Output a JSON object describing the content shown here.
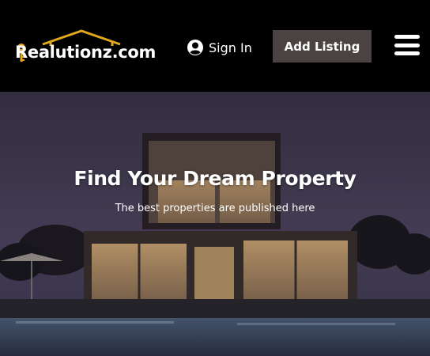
{
  "header": {
    "logo": {
      "text": "Realutionz.com",
      "colors": {
        "roof": "#e2a81e",
        "key": "#e2a81e"
      }
    },
    "sign_in": {
      "label": "Sign In",
      "icon": "user-circle-icon"
    },
    "add_listing": {
      "label": "Add Listing",
      "background": "#4a4341"
    },
    "menu": {
      "icon": "hamburger-menu-icon"
    }
  },
  "hero": {
    "title": "Find Your Dream Property",
    "subtitle": "The best properties are published here"
  }
}
